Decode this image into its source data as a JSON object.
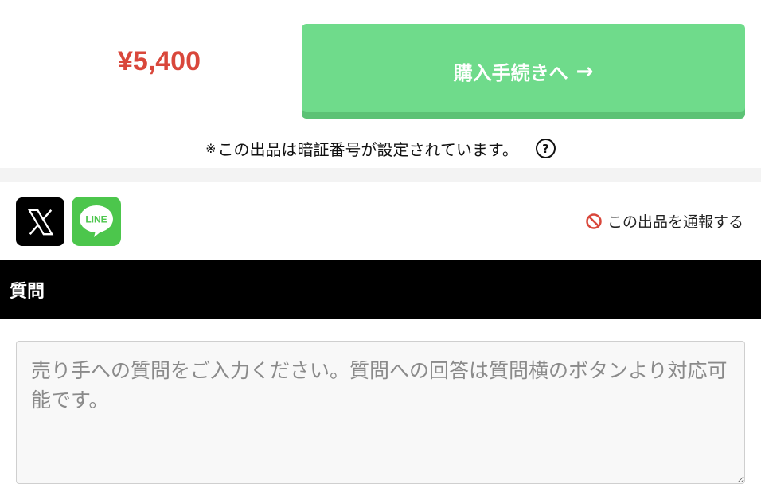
{
  "purchase": {
    "price": "¥5,400",
    "button_label": "購入手続きへ",
    "button_arrow": "→"
  },
  "notice": {
    "mark": "※",
    "text": "この出品は暗証番号が設定されています。",
    "help_glyph": "?"
  },
  "share": {
    "x_icon": "x-logo-icon",
    "line_icon": "line-logo-icon",
    "line_text": "LINE"
  },
  "report": {
    "icon": "prohibited-icon",
    "label": "この出品を通報する",
    "icon_color": "#d9473b"
  },
  "questions": {
    "header": "質問",
    "placeholder": "売り手への質問をご入力ください。質問への回答は質問横のボタンより対応可能です。"
  },
  "colors": {
    "price": "#d9473b",
    "buy_button": "#6fdb8b",
    "line_brand": "#4cc64c",
    "header_bg": "#000000"
  }
}
